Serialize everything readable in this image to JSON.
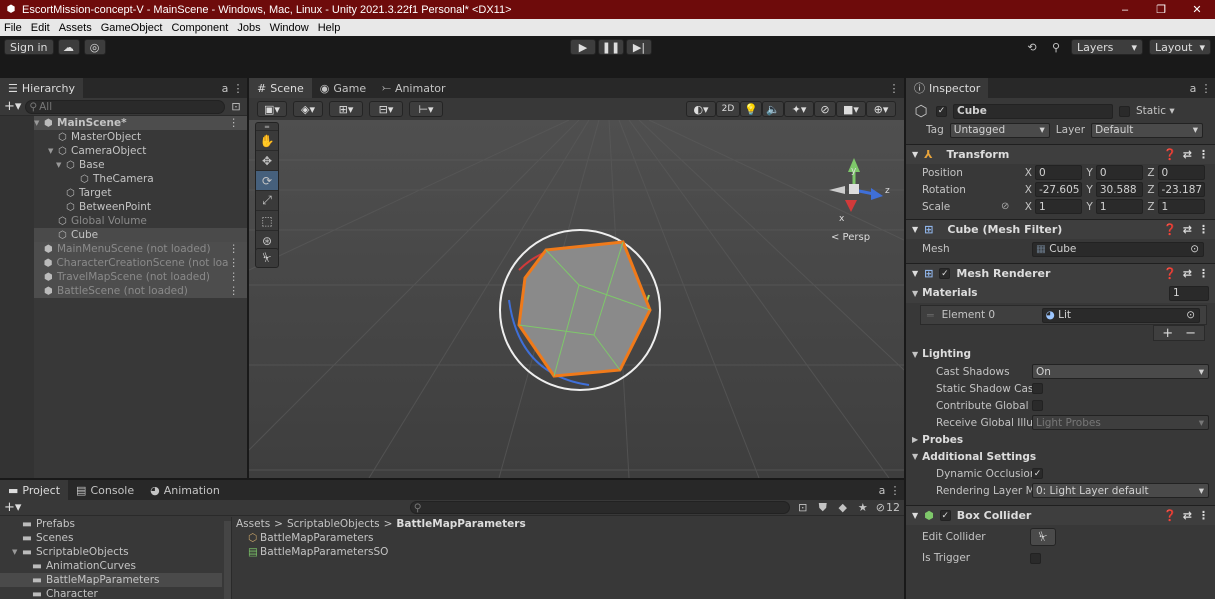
{
  "window": {
    "title": "EscortMission-concept-V - MainScene - Windows, Mac, Linux - Unity 2021.3.22f1 Personal* <DX11>",
    "controls": [
      "–",
      "❐",
      "✕"
    ]
  },
  "menu": [
    "File",
    "Edit",
    "Assets",
    "GameObject",
    "Component",
    "Jobs",
    "Window",
    "Help"
  ],
  "toolbar": {
    "sign_in": "Sign in",
    "layers": "Layers",
    "layout": "Layout"
  },
  "hierarchy": {
    "tab": "Hierarchy",
    "search_placeholder": "All",
    "items": [
      {
        "label": "MainScene*",
        "kind": "scene"
      },
      {
        "label": "MasterObject",
        "kind": "obj"
      },
      {
        "label": "CameraObject",
        "kind": "obj"
      },
      {
        "label": "Base",
        "kind": "obj"
      },
      {
        "label": "TheCamera",
        "kind": "obj"
      },
      {
        "label": "Target",
        "kind": "obj"
      },
      {
        "label": "BetweenPoint",
        "kind": "obj"
      },
      {
        "label": "Global Volume",
        "kind": "obj-dim"
      },
      {
        "label": "Cube",
        "kind": "obj-sel"
      },
      {
        "label": "MainMenuScene (not loaded)",
        "kind": "scene-unloaded"
      },
      {
        "label": "CharacterCreationScene (not loa",
        "kind": "scene-unloaded"
      },
      {
        "label": "TravelMapScene (not loaded)",
        "kind": "scene-unloaded"
      },
      {
        "label": "BattleScene (not loaded)",
        "kind": "scene-unloaded"
      }
    ]
  },
  "scene_view": {
    "tabs": [
      "Scene",
      "Game",
      "Animator"
    ],
    "mode_2d": "2D",
    "persp_label": "< Persp",
    "gizmo_axes": {
      "y": "y",
      "z": "z",
      "x": "x"
    }
  },
  "project": {
    "tabs": [
      "Project",
      "Console",
      "Animation"
    ],
    "hidden_count": "12",
    "breadcrumb": [
      "Assets",
      "ScriptableObjects",
      "BattleMapParameters"
    ],
    "tree": [
      {
        "label": "Prefabs",
        "level": 1
      },
      {
        "label": "Scenes",
        "level": 1
      },
      {
        "label": "ScriptableObjects",
        "level": 1,
        "open": true
      },
      {
        "label": "AnimationCurves",
        "level": 2
      },
      {
        "label": "BattleMapParameters",
        "level": 2,
        "selected": true
      },
      {
        "label": "Character",
        "level": 2
      }
    ],
    "files": [
      "BattleMapParameters",
      "BattleMapParametersSO"
    ]
  },
  "inspector": {
    "tab": "Inspector",
    "object_name": "Cube",
    "static_label": "Static",
    "tag_label": "Tag",
    "tag_value": "Untagged",
    "layer_label": "Layer",
    "layer_value": "Default",
    "transform": {
      "title": "Transform",
      "position_label": "Position",
      "rotation_label": "Rotation",
      "scale_label": "Scale",
      "position": [
        "0",
        "0",
        "0"
      ],
      "rotation": [
        "-27.605",
        "30.588",
        "-23.187"
      ],
      "scale": [
        "1",
        "1",
        "1"
      ]
    },
    "mesh_filter": {
      "title": "Cube (Mesh Filter)",
      "mesh_label": "Mesh",
      "mesh_value": "Cube"
    },
    "mesh_renderer": {
      "title": "Mesh Renderer",
      "materials_label": "Materials",
      "materials_count": "1",
      "element0_label": "Element 0",
      "element0_value": "Lit",
      "lighting_label": "Lighting",
      "cast_shadows_label": "Cast Shadows",
      "cast_shadows_value": "On",
      "static_shadow_label": "Static Shadow Cas",
      "contribute_gi_label": "Contribute Global I",
      "receive_gi_label": "Receive Global Illu",
      "receive_gi_value": "Light Probes",
      "probes_label": "Probes",
      "additional_label": "Additional Settings",
      "dyn_occlusion_label": "Dynamic Occlusion",
      "rendering_layer_label": "Rendering Layer M",
      "rendering_layer_value": "0: Light Layer default"
    },
    "box_collider": {
      "title": "Box Collider",
      "edit_collider_label": "Edit Collider",
      "is_trigger_label": "Is Trigger"
    }
  },
  "colors": {
    "titlebar": "#6e0b0b",
    "selection": "#46607c",
    "cube_outline": "#f07a1a"
  }
}
